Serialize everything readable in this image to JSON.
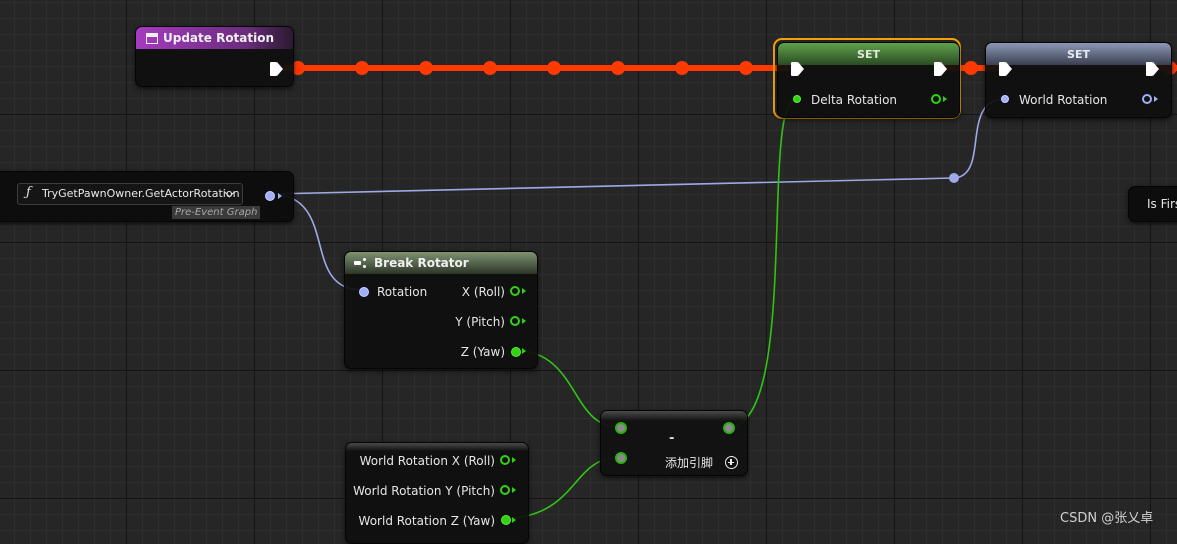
{
  "nodes": {
    "update_rotation": {
      "title": "Update Rotation",
      "header_color": "#8a2fa0"
    },
    "set_delta": {
      "title": "SET",
      "pin_label": "Delta Rotation",
      "header_color": "#4f8a3c",
      "selection_color": "#f2a20b"
    },
    "set_world": {
      "title": "SET",
      "pin_label": "World Rotation",
      "header_color": "#6c7a9a"
    },
    "get_rotation": {
      "function_label": "TryGetPawnOwner.GetActorRotation",
      "subtitle": "Pre-Event Graph",
      "icon": "function-icon"
    },
    "break_rotator": {
      "title": "Break Rotator",
      "input_label": "Rotation",
      "outputs": [
        "X (Roll)",
        "Y (Pitch)",
        "Z (Yaw)"
      ]
    },
    "subtract": {
      "operator": "-",
      "add_pin_label": "添加引脚"
    },
    "world_rotation_break": {
      "outputs": [
        "World Rotation X (Roll)",
        "World Rotation Y (Pitch)",
        "World Rotation Z (Yaw)"
      ]
    },
    "is_first": {
      "label": "Is First"
    }
  },
  "colors": {
    "exec_wire": "#ff3a00",
    "float_wire": "#2fc414",
    "rotator_wire": "#9fa9e6",
    "background": "#262626"
  },
  "watermark": "CSDN @张乂卓"
}
